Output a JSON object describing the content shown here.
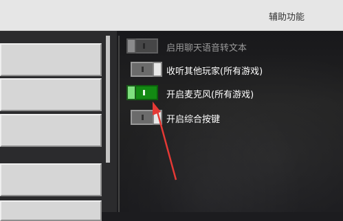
{
  "header": {
    "title": "辅助功能"
  },
  "toggles": [
    {
      "label": "启用聊天语音转文本",
      "state": "off",
      "enabled": false
    },
    {
      "label": "收听其他玩家(所有游戏)",
      "state": "off",
      "enabled": true
    },
    {
      "label": "开启麦克风(所有游戏)",
      "state": "on",
      "enabled": true
    },
    {
      "label": "开启综合按键",
      "state": "off",
      "enabled": true
    }
  ],
  "colors": {
    "toggle_on": "#138a13",
    "annotation_arrow": "#e53935"
  }
}
